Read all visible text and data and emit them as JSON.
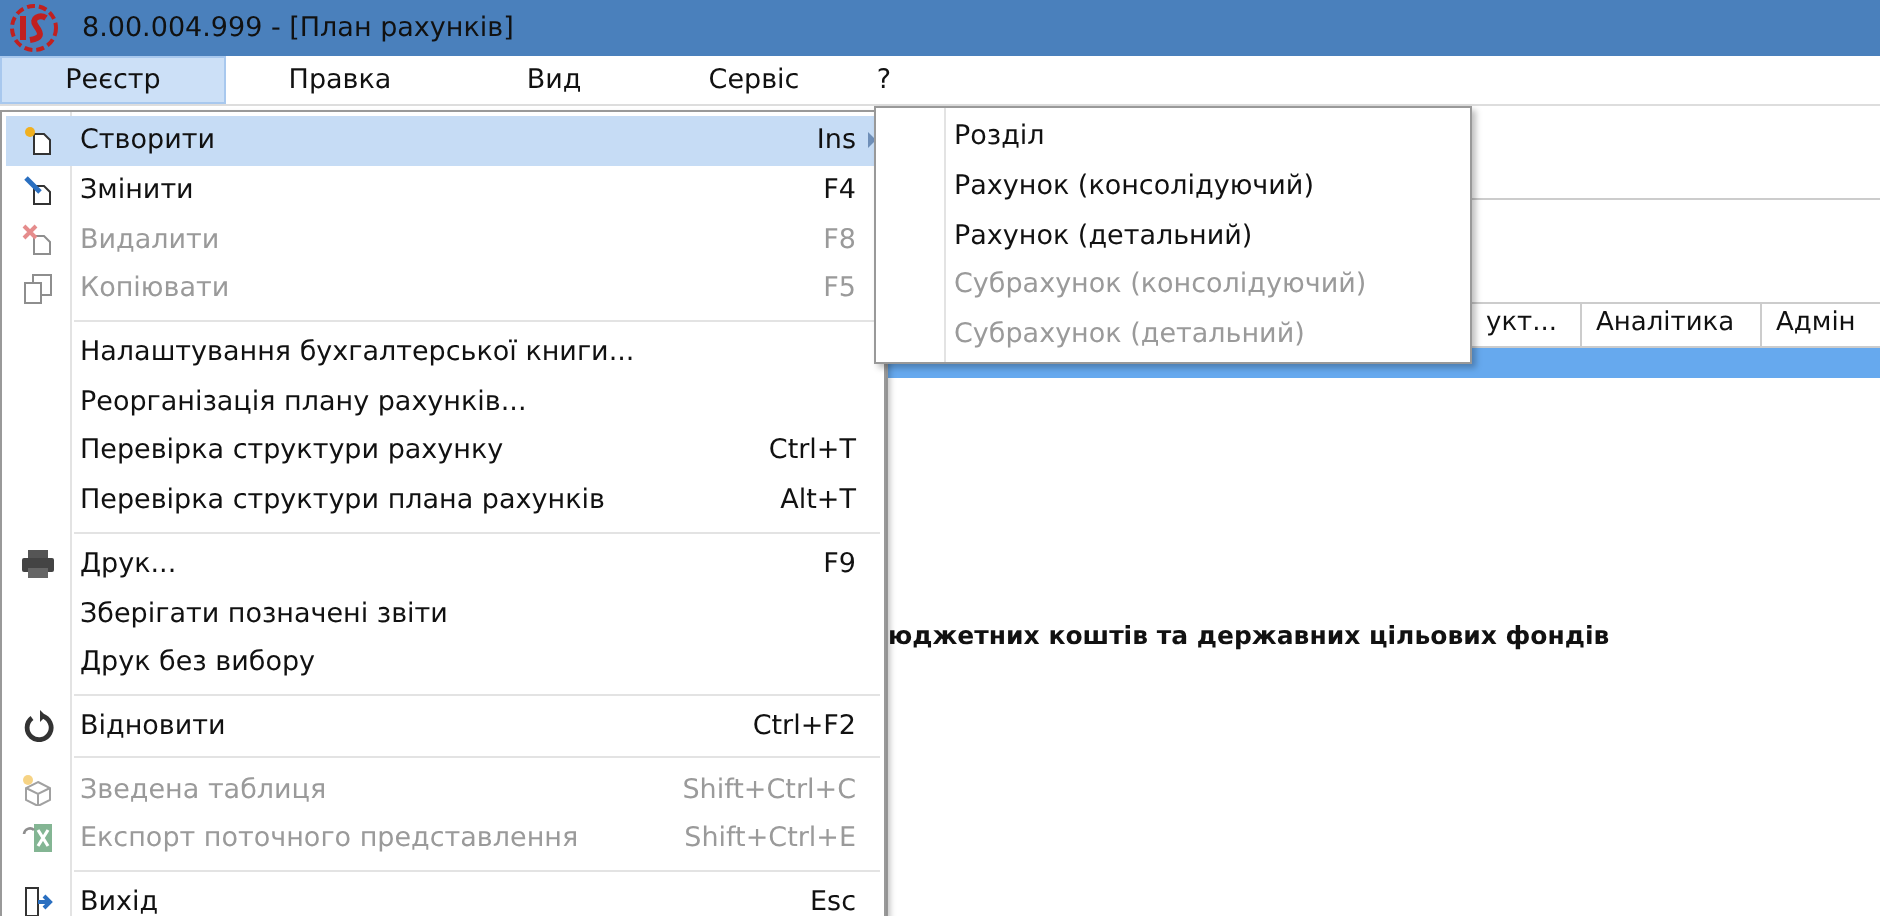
{
  "window": {
    "title": "8.00.004.999 - [План рахунків]"
  },
  "menubar": [
    {
      "label": "Реєстр",
      "selected": true
    },
    {
      "label": "Правка",
      "selected": false
    },
    {
      "label": "Вид",
      "selected": false
    },
    {
      "label": "Сервіс",
      "selected": false
    },
    {
      "label": "?",
      "selected": false
    }
  ],
  "menu": [
    {
      "kind": "new",
      "label": "Створити",
      "shortcut": "Ins",
      "disabled": false,
      "selected": true,
      "submenu": true
    },
    {
      "kind": "edit",
      "label": "Змінити",
      "shortcut": "F4",
      "disabled": false,
      "selected": false
    },
    {
      "kind": "delete",
      "label": "Видалити",
      "shortcut": "F8",
      "disabled": true,
      "selected": false
    },
    {
      "kind": "copy",
      "label": "Копіювати",
      "shortcut": "F5",
      "disabled": true,
      "selected": false
    },
    {
      "kind": "separator"
    },
    {
      "kind": "item",
      "label": "Налаштування бухгалтерської книги...",
      "disabled": false,
      "selected": false
    },
    {
      "kind": "item",
      "label": "Реорганізація плану рахунків...",
      "disabled": false,
      "selected": false
    },
    {
      "kind": "item",
      "label": "Перевірка структури рахунку",
      "shortcut": "Ctrl+T",
      "disabled": false,
      "selected": false
    },
    {
      "kind": "item",
      "label": "Перевірка структури плана рахунків",
      "shortcut": "Alt+T",
      "disabled": false,
      "selected": false
    },
    {
      "kind": "separator"
    },
    {
      "kind": "print",
      "label": "Друк...",
      "shortcut": "F9",
      "disabled": false,
      "selected": false
    },
    {
      "kind": "item",
      "label": "Зберігати позначені звіти",
      "disabled": false,
      "selected": false
    },
    {
      "kind": "item",
      "label": "Друк без вибору",
      "disabled": false,
      "selected": false
    },
    {
      "kind": "separator"
    },
    {
      "kind": "restore",
      "label": "Відновити",
      "shortcut": "Ctrl+F2",
      "disabled": false,
      "selected": false
    },
    {
      "kind": "separator"
    },
    {
      "kind": "cube",
      "label": "Зведена таблиця",
      "shortcut": "Shift+Ctrl+C",
      "disabled": true,
      "selected": false
    },
    {
      "kind": "spreadsheet",
      "label": "Експорт поточного представлення",
      "shortcut": "Shift+Ctrl+E",
      "disabled": true,
      "selected": false
    },
    {
      "kind": "separator"
    },
    {
      "kind": "exit",
      "label": "Вихід",
      "shortcut": "Esc",
      "disabled": false,
      "selected": false
    }
  ],
  "submenu": [
    {
      "kind": "item",
      "label": "Розділ",
      "disabled": false,
      "selected": false
    },
    {
      "kind": "item",
      "label": "Рахунок (консолідуючий)",
      "disabled": false,
      "selected": false
    },
    {
      "kind": "item",
      "label": "Рахунок (детальний)",
      "disabled": false,
      "selected": false
    },
    {
      "kind": "item",
      "label": "Субрахунок (консолідуючий)",
      "disabled": true,
      "selected": false
    },
    {
      "kind": "item",
      "label": "Субрахунок (детальний)",
      "disabled": true,
      "selected": false
    }
  ],
  "table": {
    "columns": [
      "укт...",
      "Аналітика",
      "Адмін"
    ]
  },
  "heading": "юджетних коштів та державних цільових фондів"
}
